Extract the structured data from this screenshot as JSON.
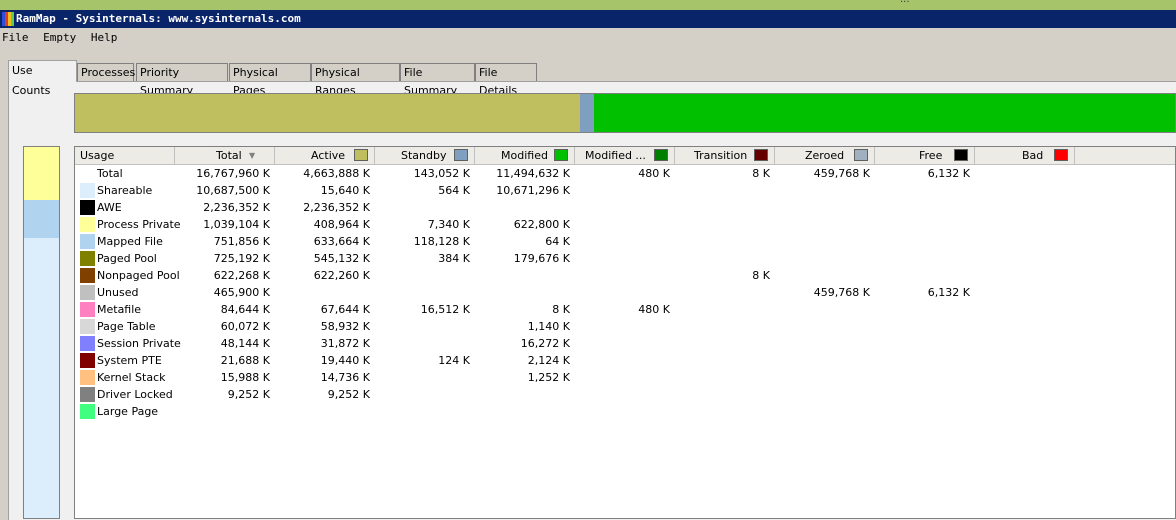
{
  "window": {
    "title": "RamMap - Sysinternals: www.sysinternals.com",
    "top_strip_text": "...",
    "icon_colors": [
      "#2d4fd8",
      "#e23a2a",
      "#f0c020",
      "#5fcf4f"
    ]
  },
  "menu": [
    "File",
    "Empty",
    "Help"
  ],
  "tabs": [
    "Use Counts",
    "Processes",
    "Priority Summary",
    "Physical Pages",
    "Physical Ranges",
    "File Summary",
    "File Details"
  ],
  "active_tab": "Use Counts",
  "overview_bar": {
    "segments": [
      {
        "name": "active",
        "color": "#bfbf60",
        "fraction": 0.459
      },
      {
        "name": "standby",
        "color": "#7f9fc0",
        "fraction": 0.0128
      },
      {
        "name": "modified",
        "color": "#00c000",
        "fraction": 0.528
      }
    ]
  },
  "left_bar": {
    "segments": [
      {
        "name": "process-private",
        "color": "#ffff99",
        "fraction": 0.143
      },
      {
        "name": "mapped-file",
        "color": "#b0d4f0",
        "fraction": 0.102
      },
      {
        "name": "shareable",
        "color": "#dceefb",
        "fraction": 0.755
      }
    ]
  },
  "columns": [
    {
      "label": "Usage",
      "swatch": null
    },
    {
      "label": "Total",
      "swatch": null,
      "sorted": true
    },
    {
      "label": "Active",
      "swatch": "#bfbf60"
    },
    {
      "label": "Standby",
      "swatch": "#7f9fc0"
    },
    {
      "label": "Modified",
      "swatch": "#00c000"
    },
    {
      "label": "Modified ...",
      "swatch": "#007f00"
    },
    {
      "label": "Transition",
      "swatch": "#660000"
    },
    {
      "label": "Zeroed",
      "swatch": "#a0b0c0"
    },
    {
      "label": "Free",
      "swatch": "#000000"
    },
    {
      "label": "Bad",
      "swatch": "#ff0000"
    }
  ],
  "rows": [
    {
      "usage": "Total",
      "color": null,
      "total": "16,767,960 K",
      "active": "4,663,888 K",
      "standby": "143,052 K",
      "modified": "11,494,632 K",
      "modified_nw": "480 K",
      "transition": "8 K",
      "zeroed": "459,768 K",
      "free": "6,132 K",
      "bad": ""
    },
    {
      "usage": "Shareable",
      "color": "#dceefb",
      "total": "10,687,500 K",
      "active": "15,640 K",
      "standby": "564 K",
      "modified": "10,671,296 K",
      "modified_nw": "",
      "transition": "",
      "zeroed": "",
      "free": "",
      "bad": ""
    },
    {
      "usage": "AWE",
      "color": "#000000",
      "total": "2,236,352 K",
      "active": "2,236,352 K",
      "standby": "",
      "modified": "",
      "modified_nw": "",
      "transition": "",
      "zeroed": "",
      "free": "",
      "bad": ""
    },
    {
      "usage": "Process Private",
      "color": "#ffff99",
      "total": "1,039,104 K",
      "active": "408,964 K",
      "standby": "7,340 K",
      "modified": "622,800 K",
      "modified_nw": "",
      "transition": "",
      "zeroed": "",
      "free": "",
      "bad": ""
    },
    {
      "usage": "Mapped File",
      "color": "#b0d4f0",
      "total": "751,856 K",
      "active": "633,664 K",
      "standby": "118,128 K",
      "modified": "64 K",
      "modified_nw": "",
      "transition": "",
      "zeroed": "",
      "free": "",
      "bad": ""
    },
    {
      "usage": "Paged Pool",
      "color": "#808000",
      "total": "725,192 K",
      "active": "545,132 K",
      "standby": "384 K",
      "modified": "179,676 K",
      "modified_nw": "",
      "transition": "",
      "zeroed": "",
      "free": "",
      "bad": ""
    },
    {
      "usage": "Nonpaged Pool",
      "color": "#804000",
      "total": "622,268 K",
      "active": "622,260 K",
      "standby": "",
      "modified": "",
      "modified_nw": "",
      "transition": "8 K",
      "zeroed": "",
      "free": "",
      "bad": ""
    },
    {
      "usage": "Unused",
      "color": "#c0c0c0",
      "total": "465,900 K",
      "active": "",
      "standby": "",
      "modified": "",
      "modified_nw": "",
      "transition": "",
      "zeroed": "459,768 K",
      "free": "6,132 K",
      "bad": ""
    },
    {
      "usage": "Metafile",
      "color": "#ff80c0",
      "total": "84,644 K",
      "active": "67,644 K",
      "standby": "16,512 K",
      "modified": "8 K",
      "modified_nw": "480 K",
      "transition": "",
      "zeroed": "",
      "free": "",
      "bad": ""
    },
    {
      "usage": "Page Table",
      "color": "#d8d8d8",
      "total": "60,072 K",
      "active": "58,932 K",
      "standby": "",
      "modified": "1,140 K",
      "modified_nw": "",
      "transition": "",
      "zeroed": "",
      "free": "",
      "bad": ""
    },
    {
      "usage": "Session Private",
      "color": "#8080ff",
      "total": "48,144 K",
      "active": "31,872 K",
      "standby": "",
      "modified": "16,272 K",
      "modified_nw": "",
      "transition": "",
      "zeroed": "",
      "free": "",
      "bad": ""
    },
    {
      "usage": "System PTE",
      "color": "#800000",
      "total": "21,688 K",
      "active": "19,440 K",
      "standby": "124 K",
      "modified": "2,124 K",
      "modified_nw": "",
      "transition": "",
      "zeroed": "",
      "free": "",
      "bad": ""
    },
    {
      "usage": "Kernel Stack",
      "color": "#ffc080",
      "total": "15,988 K",
      "active": "14,736 K",
      "standby": "",
      "modified": "1,252 K",
      "modified_nw": "",
      "transition": "",
      "zeroed": "",
      "free": "",
      "bad": ""
    },
    {
      "usage": "Driver Locked",
      "color": "#808080",
      "total": "9,252 K",
      "active": "9,252 K",
      "standby": "",
      "modified": "",
      "modified_nw": "",
      "transition": "",
      "zeroed": "",
      "free": "",
      "bad": ""
    },
    {
      "usage": "Large Page",
      "color": "#40ff80",
      "total": "",
      "active": "",
      "standby": "",
      "modified": "",
      "modified_nw": "",
      "transition": "",
      "zeroed": "",
      "free": "",
      "bad": ""
    }
  ]
}
